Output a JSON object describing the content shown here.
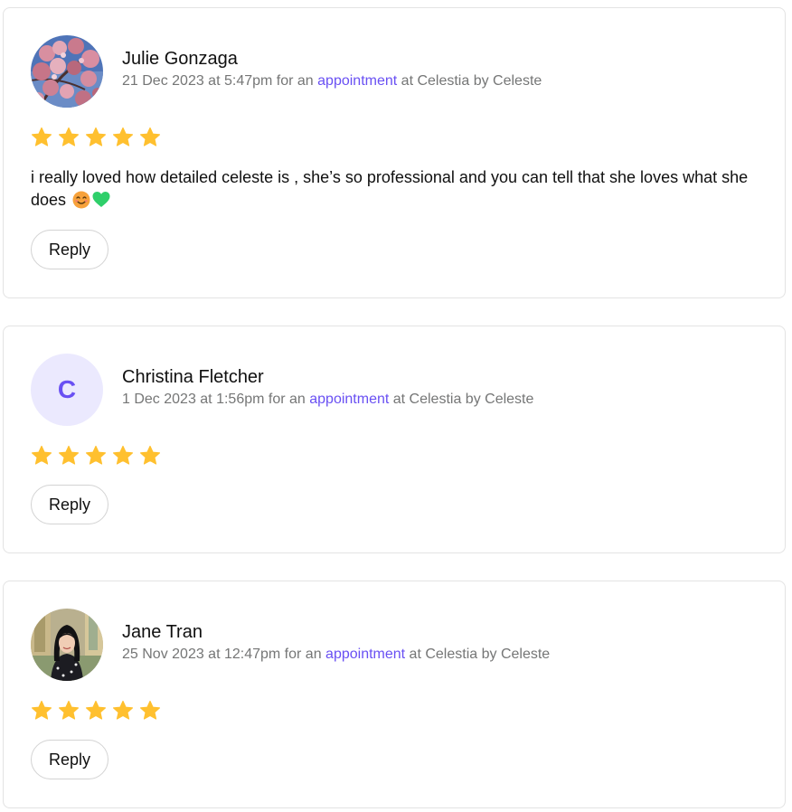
{
  "reviews": [
    {
      "name": "Julie Gonzaga",
      "date": "21 Dec 2023 at 5:47pm",
      "for_text": " for an ",
      "link_text": "appointment",
      "at_text": " at Celestia by Celeste",
      "rating": 5,
      "text": "i really loved how detailed celeste is , she’s so professional and you can tell that she loves what she does",
      "emojis": [
        "smiling-face-emoji",
        "green-heart-emoji"
      ],
      "reply_label": "Reply",
      "avatar": "photo-pink-blossoms"
    },
    {
      "name": "Christina Fletcher",
      "date": "1 Dec 2023 at 1:56pm",
      "for_text": " for an ",
      "link_text": "appointment",
      "at_text": " at Celestia by Celeste",
      "rating": 5,
      "avatar_initial": "C",
      "reply_label": "Reply"
    },
    {
      "name": "Jane Tran",
      "date": "25 Nov 2023 at 12:47pm",
      "for_text": " for an ",
      "link_text": "appointment",
      "at_text": " at Celestia by Celeste",
      "rating": 5,
      "reply_label": "Reply",
      "avatar": "photo-woman-portrait"
    }
  ],
  "colors": {
    "accent": "#6950f3",
    "star": "#ffc02f",
    "muted_text": "#757676",
    "avatar_initial_bg": "#ebe9fe"
  }
}
